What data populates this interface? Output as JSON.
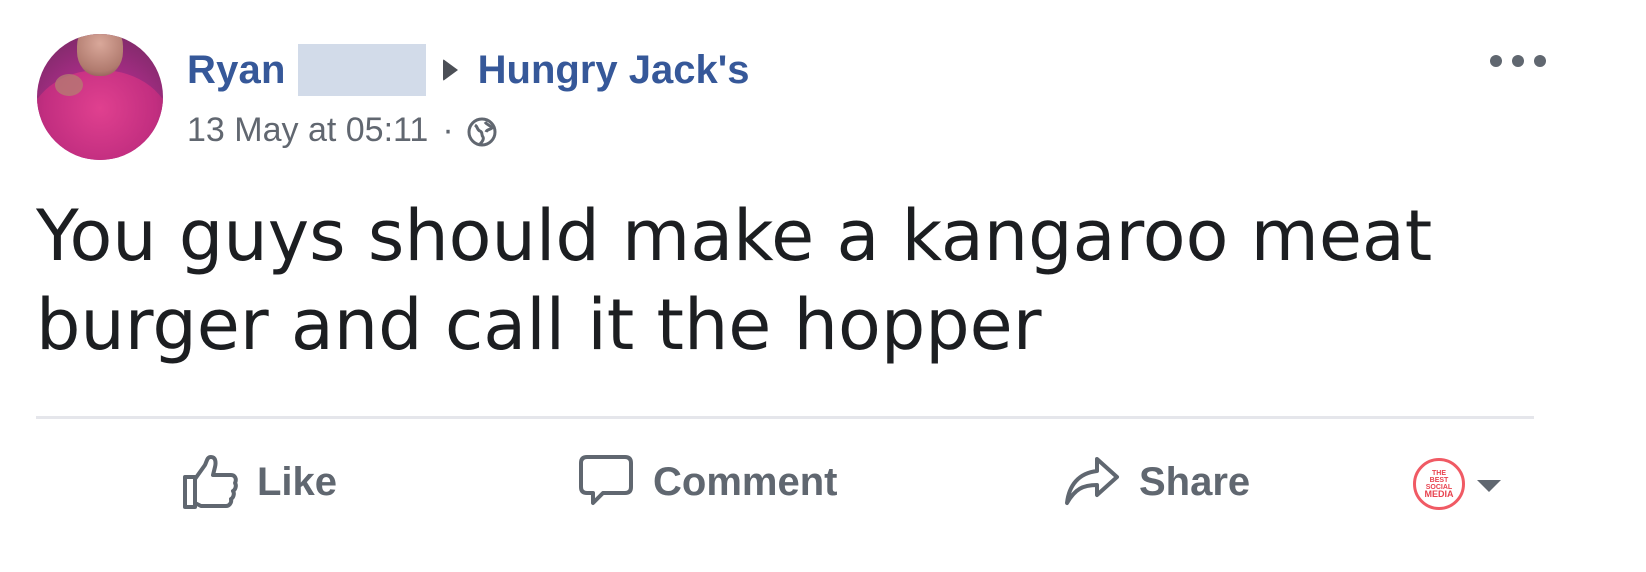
{
  "post": {
    "author_first_name": "Ryan",
    "target_page": "Hungry Jack's",
    "timestamp": "13 May at 05:11",
    "separator": "·",
    "privacy_icon": "globe-icon",
    "more_icon": "ellipsis-icon",
    "text": "You guys should make a kangaroo meat burger and call it the hopper"
  },
  "actions": {
    "like_label": "Like",
    "comment_label": "Comment",
    "share_label": "Share",
    "like_icon": "thumbs-up-icon",
    "comment_icon": "speech-bubble-icon",
    "share_icon": "share-arrow-icon"
  },
  "page_avatar": {
    "logo_lines": [
      "THE",
      "BEST",
      "SOCIAL",
      "MEDIA"
    ],
    "accent": "#f05a64"
  },
  "colors": {
    "link": "#365899",
    "secondary_text": "#616770",
    "body_text": "#1c1e21"
  }
}
